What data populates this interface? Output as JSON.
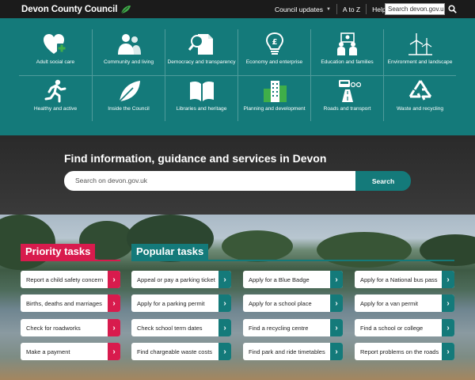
{
  "header": {
    "brand": "Devon County Council",
    "nav": [
      "Council updates",
      "A to Z",
      "Help"
    ],
    "search_value": "Search devon.gov.uk"
  },
  "categories": [
    {
      "label": "Adult social care",
      "icon": "heart-plus-icon"
    },
    {
      "label": "Community and living",
      "icon": "people-icon"
    },
    {
      "label": "Democracy and transparency",
      "icon": "document-magnifier-icon"
    },
    {
      "label": "Economy and enterprise",
      "icon": "lightbulb-pound-icon"
    },
    {
      "label": "Education and families",
      "icon": "family-icon"
    },
    {
      "label": "Environment and landscape",
      "icon": "wind-turbine-icon"
    },
    {
      "label": "Healthy and active",
      "icon": "running-person-icon"
    },
    {
      "label": "Inside the Council",
      "icon": "leaf-icon"
    },
    {
      "label": "Libraries and heritage",
      "icon": "open-book-icon"
    },
    {
      "label": "Planning and development",
      "icon": "buildings-icon"
    },
    {
      "label": "Roads and transport",
      "icon": "road-bus-icon"
    },
    {
      "label": "Waste and recycling",
      "icon": "recycle-icon"
    }
  ],
  "hero": {
    "title": "Find information, guidance and services in Devon",
    "placeholder": "Search on devon.gov.uk",
    "button": "Search"
  },
  "priority": {
    "heading": "Priority tasks",
    "items": [
      "Report a child safety concern",
      "Births, deaths and marriages",
      "Check for roadworks",
      "Make a payment"
    ]
  },
  "popular": {
    "heading": "Popular tasks",
    "columns": [
      [
        "Appeal or pay a parking ticket",
        "Apply for a parking permit",
        "Check school term dates",
        "Find chargeable waste costs"
      ],
      [
        "Apply for a Blue Badge",
        "Apply for a school place",
        "Find a recycling centre",
        "Find park and ride timetables"
      ],
      [
        "Apply for a National bus pass",
        "Apply for a van permit",
        "Find a school or college",
        "Report problems on the roads"
      ]
    ]
  },
  "colors": {
    "teal": "#147a7a",
    "pink": "#d81b4d",
    "topbar": "#1b1b1b"
  }
}
